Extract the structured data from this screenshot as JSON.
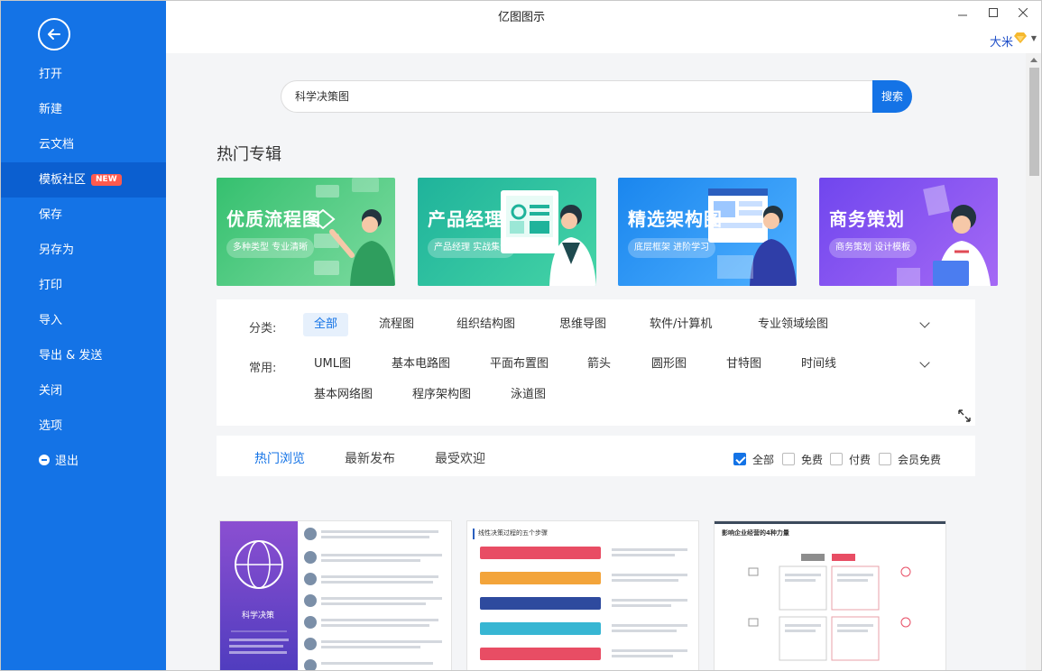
{
  "window": {
    "title": "亿图图示",
    "minimize_icon": "minimize-icon",
    "maximize_icon": "maximize-icon",
    "close_icon": "close-icon",
    "user_name": "大米",
    "vip_icon": "diamond-icon"
  },
  "sidebar": {
    "back_icon": "back-arrow-icon",
    "items": [
      {
        "label": "打开"
      },
      {
        "label": "新建"
      },
      {
        "label": "云文档"
      },
      {
        "label": "模板社区",
        "badge": "NEW",
        "active": true
      },
      {
        "label": "保存"
      },
      {
        "label": "另存为"
      },
      {
        "label": "打印"
      },
      {
        "label": "导入"
      },
      {
        "label": "导出 & 发送"
      },
      {
        "label": "关闭"
      },
      {
        "label": "选项"
      },
      {
        "label": "退出",
        "icon": "exit-icon"
      }
    ]
  },
  "search": {
    "value": "科学决策图",
    "button": "搜索"
  },
  "hot_topics": {
    "title": "热门专辑",
    "banners": [
      {
        "title": "优质流程图",
        "tag": "多种类型 专业清晰",
        "color": "#3cc47a"
      },
      {
        "title": "产品经理",
        "tag": "产品经理 实战集合",
        "color": "#26b99a"
      },
      {
        "title": "精选架构图",
        "tag": "底层框架 进阶学习",
        "color": "#1e8df0"
      },
      {
        "title": "商务策划",
        "tag": "商务策划 设计模板",
        "color": "#7b4ef0"
      }
    ]
  },
  "filters": {
    "category_label": "分类:",
    "categories": [
      "全部",
      "流程图",
      "组织结构图",
      "思维导图",
      "软件/计算机",
      "专业领域绘图"
    ],
    "common_label": "常用:",
    "common_row1": [
      "UML图",
      "基本电路图",
      "平面布置图",
      "箭头",
      "圆形图",
      "甘特图",
      "时间线"
    ],
    "common_row2": [
      "基本网络图",
      "程序架构图",
      "泳道图"
    ],
    "accent": "#1473e6"
  },
  "sort_tabs": [
    "热门浏览",
    "最新发布",
    "最受欢迎"
  ],
  "price_filters": [
    {
      "label": "全部",
      "checked": true
    },
    {
      "label": "免费",
      "checked": false
    },
    {
      "label": "付费",
      "checked": false
    },
    {
      "label": "会员免费",
      "checked": false
    }
  ],
  "templates": [
    {
      "caption": "科学决策"
    },
    {
      "caption": "线性决策过程的五个步骤"
    },
    {
      "caption": "影响企业经营的4种力量"
    }
  ]
}
